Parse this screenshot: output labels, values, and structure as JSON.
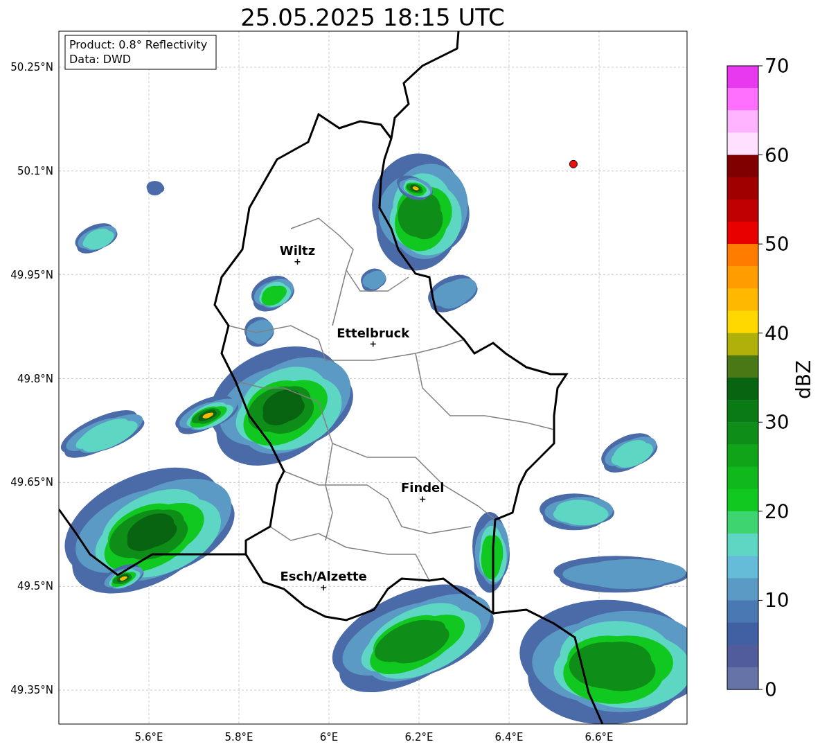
{
  "title": "25.05.2025 18:15 UTC",
  "info_box": [
    "Product: 0.8° Reflectivity",
    "Data: DWD"
  ],
  "y_ticks": [
    "50.25°N",
    "50.1°N",
    "49.95°N",
    "49.8°N",
    "49.65°N",
    "49.5°N",
    "49.35°N"
  ],
  "x_ticks": [
    "5.6°E",
    "5.8°E",
    "6°E",
    "6.2°E",
    "6.4°E",
    "6.6°E"
  ],
  "cities": [
    "Wiltz",
    "Ettelbruck",
    "Findel",
    "Esch/Alzette"
  ],
  "site_marker": {
    "color": "#ee1111"
  },
  "colorbar": {
    "label": "dBZ",
    "ticks": [
      "70",
      "60",
      "50",
      "40",
      "30",
      "20",
      "10",
      "0"
    ],
    "segments": [
      {
        "color": "#e838f0"
      },
      {
        "color": "#ff70ff"
      },
      {
        "color": "#ffb4ff"
      },
      {
        "color": "#ffe0ff"
      },
      {
        "color": "#800000"
      },
      {
        "color": "#a00000"
      },
      {
        "color": "#c00000"
      },
      {
        "color": "#e80000"
      },
      {
        "color": "#ff7c00"
      },
      {
        "color": "#ff9c00"
      },
      {
        "color": "#ffb800"
      },
      {
        "color": "#ffd800"
      },
      {
        "color": "#b0b00a"
      },
      {
        "color": "#4a7814"
      },
      {
        "color": "#086410"
      },
      {
        "color": "#0a7a14"
      },
      {
        "color": "#0e8e18"
      },
      {
        "color": "#10a418"
      },
      {
        "color": "#10b81c"
      },
      {
        "color": "#10c820"
      },
      {
        "color": "#3ed470"
      },
      {
        "color": "#5ed6c4"
      },
      {
        "color": "#64bcd8"
      },
      {
        "color": "#5a9ac4"
      },
      {
        "color": "#4a78b2"
      },
      {
        "color": "#4160a4"
      },
      {
        "color": "#515c9c"
      },
      {
        "color": "#6673a6"
      }
    ]
  }
}
